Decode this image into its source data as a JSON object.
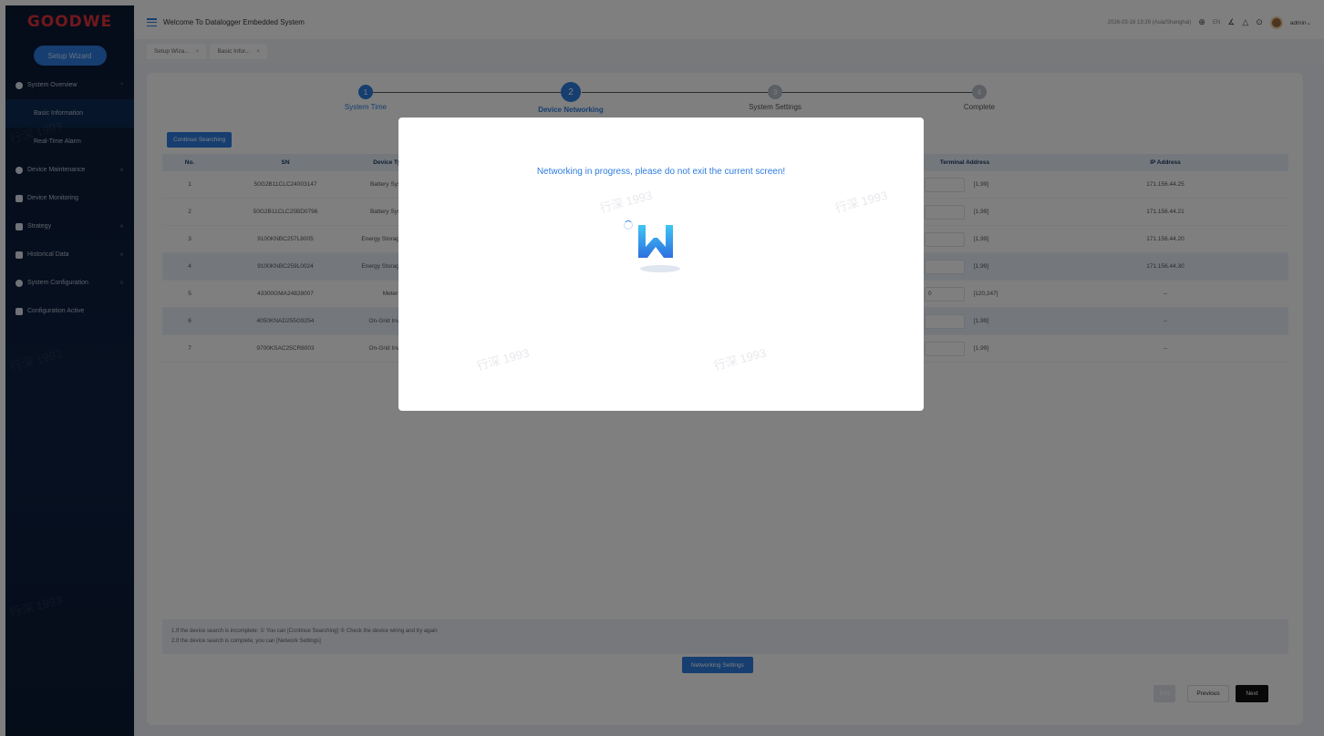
{
  "sidebar": {
    "logo": "GOODWE",
    "wizard_button": "Setup Wizard",
    "items": [
      {
        "label": "System Overview",
        "icon": "pie-chart-icon",
        "expanded": true
      },
      {
        "label": "Basic Information",
        "sub": true,
        "active": true
      },
      {
        "label": "Real-Time Alarm",
        "sub": true
      },
      {
        "label": "Device Maintenance",
        "icon": "shield-icon"
      },
      {
        "label": "Device Monitoring",
        "icon": "monitor-icon"
      },
      {
        "label": "Strategy",
        "icon": "strategy-icon"
      },
      {
        "label": "Historical Data",
        "icon": "history-icon"
      },
      {
        "label": "System Configuration",
        "icon": "gear-icon"
      },
      {
        "label": "Configuration Active",
        "icon": "config-icon"
      }
    ]
  },
  "header": {
    "title": "Welcome To Datalogger Embedded System",
    "datetime": "2026-03-16 13:26 (Asia/Shanghai)",
    "language": "EN",
    "user": "admin"
  },
  "tabs": [
    {
      "label": "Setup Wiza..."
    },
    {
      "label": "Basic Infor..."
    }
  ],
  "steps": [
    {
      "num": "1",
      "label": "System Time"
    },
    {
      "num": "2",
      "label": "Device Networking"
    },
    {
      "num": "3",
      "label": "System Settings"
    },
    {
      "num": "4",
      "label": "Complete"
    }
  ],
  "continue_search": "Continue Searching",
  "table": {
    "columns": [
      "No.",
      "SN",
      "Device Type",
      "Terminal Address",
      "IP Address"
    ],
    "rows": [
      {
        "no": "1",
        "sn": "50G2B11CLC24003147",
        "type": "Battery System",
        "range": "[1,99]",
        "ip": "171.156.44.25"
      },
      {
        "no": "2",
        "sn": "50G2B11CLC25BD0796",
        "type": "Battery System",
        "range": "[1,99]",
        "ip": "171.156.44.21"
      },
      {
        "no": "3",
        "sn": "9100KNBC257L8005",
        "type": "Energy Storage Invert",
        "range": "[1,99]",
        "ip": "171.156.44.20"
      },
      {
        "no": "4",
        "sn": "9100KNBC259L0024",
        "type": "Energy Storage Invert",
        "range": "[1,99]",
        "ip": "171.156.44.30"
      },
      {
        "no": "5",
        "sn": "43300GMA24828007",
        "type": "Meter",
        "addr": "0",
        "range": "[120,247]",
        "ip": "--"
      },
      {
        "no": "6",
        "sn": "4050KNAD255G9254",
        "type": "On-Grid Inverter",
        "range": "[1,99]",
        "ip": "--"
      },
      {
        "no": "7",
        "sn": "9700KSAC25CR8003",
        "type": "On-Grid Inverter",
        "range": "[1,99]",
        "ip": "--"
      }
    ]
  },
  "notes": {
    "line1": "1.If the device search is incomplete: ① You can [Continue Searching] ② Check the device wiring and try again",
    "line2": "2.If the device search is complete, you can [Network Settings]"
  },
  "networking_settings": "Networking Settings",
  "footer": {
    "exit": "Exit",
    "previous": "Previous",
    "next": "Next"
  },
  "modal": {
    "message": "Networking in progress, please do not exit the current screen!"
  },
  "watermark": "行深 1993",
  "colors": {
    "accent": "#2d7de0",
    "logo": "#e0313a",
    "sidebar": "#0b1a33"
  }
}
